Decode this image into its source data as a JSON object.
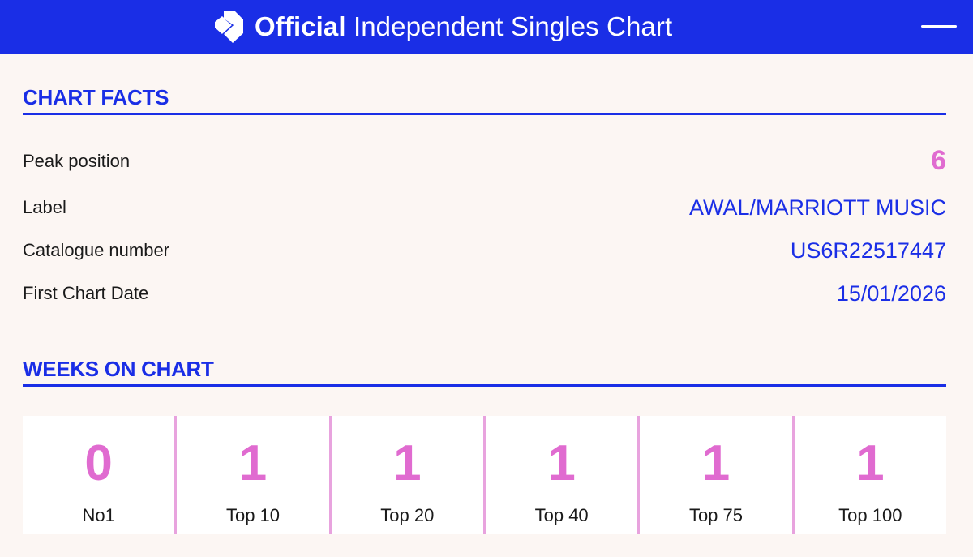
{
  "header": {
    "title_bold": "Official",
    "title_rest": "Independent Singles Chart",
    "logo_icon": "official-charts-logo-icon",
    "menu_icon": "hamburger-menu-icon"
  },
  "chart_facts": {
    "heading": "CHART FACTS",
    "rows": [
      {
        "label": "Peak position",
        "value": "6"
      },
      {
        "label": "Label",
        "value": "AWAL/MARRIOTT MUSIC"
      },
      {
        "label": "Catalogue number",
        "value": "US6R22517447"
      },
      {
        "label": "First Chart Date",
        "value": "15/01/2026"
      }
    ]
  },
  "weeks_on_chart": {
    "heading": "WEEKS ON CHART",
    "items": [
      {
        "count": "0",
        "label": "No1"
      },
      {
        "count": "1",
        "label": "Top 10"
      },
      {
        "count": "1",
        "label": "Top 20"
      },
      {
        "count": "1",
        "label": "Top 40"
      },
      {
        "count": "1",
        "label": "Top 75"
      },
      {
        "count": "1",
        "label": "Top 100"
      }
    ]
  },
  "colors": {
    "brand_blue": "#1a2ee6",
    "accent_pink": "#e06bd0",
    "background": "#fcf6f3"
  }
}
